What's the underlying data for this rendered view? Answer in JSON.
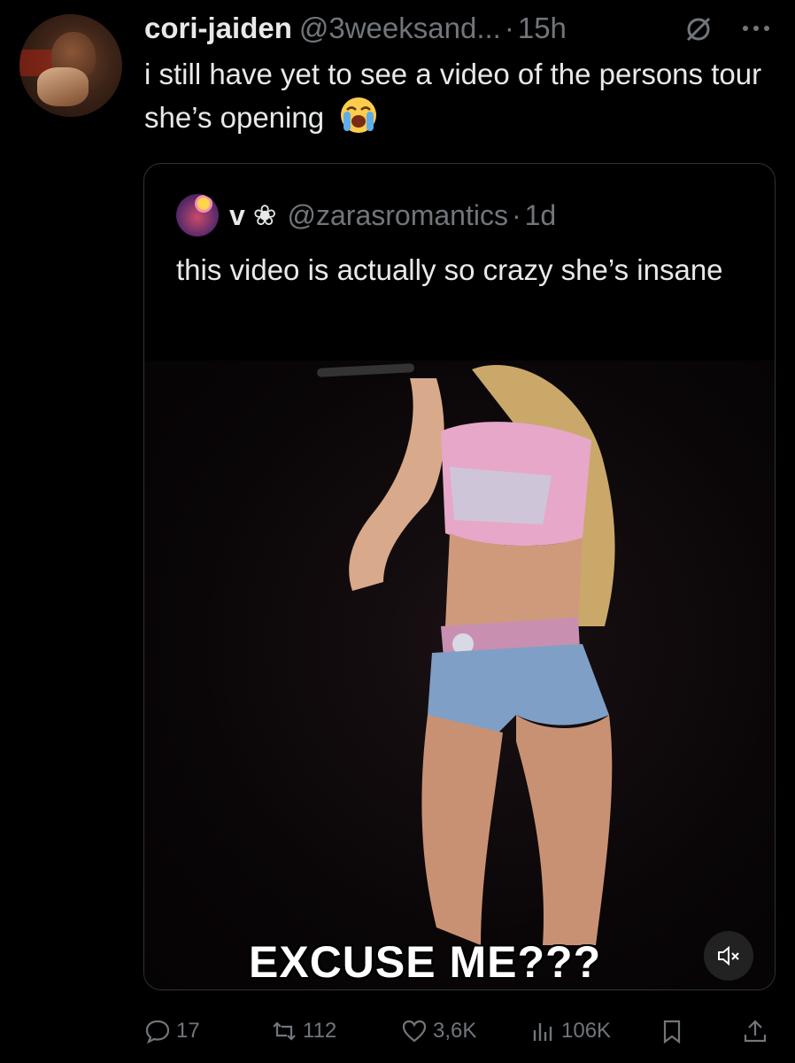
{
  "tweet": {
    "author_name": "cori-jaiden",
    "author_handle": "@3weeksand...",
    "dot": "·",
    "time": "15h",
    "text": "i still have yet to see a video of the persons tour she’s opening"
  },
  "quote": {
    "author_name": "v ❀",
    "author_handle": "@zarasromantics",
    "dot": "·",
    "time": "1d",
    "text": "this video is actually so crazy she’s insane",
    "video_caption": "EXCUSE ME???"
  },
  "actions": {
    "replies": "17",
    "reposts": "112",
    "likes": "3,6K",
    "views": "106K"
  },
  "icons": [
    "no-emoji-icon",
    "more-icon",
    "crying-face-emoji",
    "mute-icon",
    "reply-icon",
    "repost-icon",
    "like-icon",
    "views-icon",
    "bookmark-icon",
    "share-icon"
  ],
  "colors": {
    "background": "#000000",
    "text": "#e7e9ea",
    "secondary": "#71767b",
    "border": "#2f3336"
  }
}
